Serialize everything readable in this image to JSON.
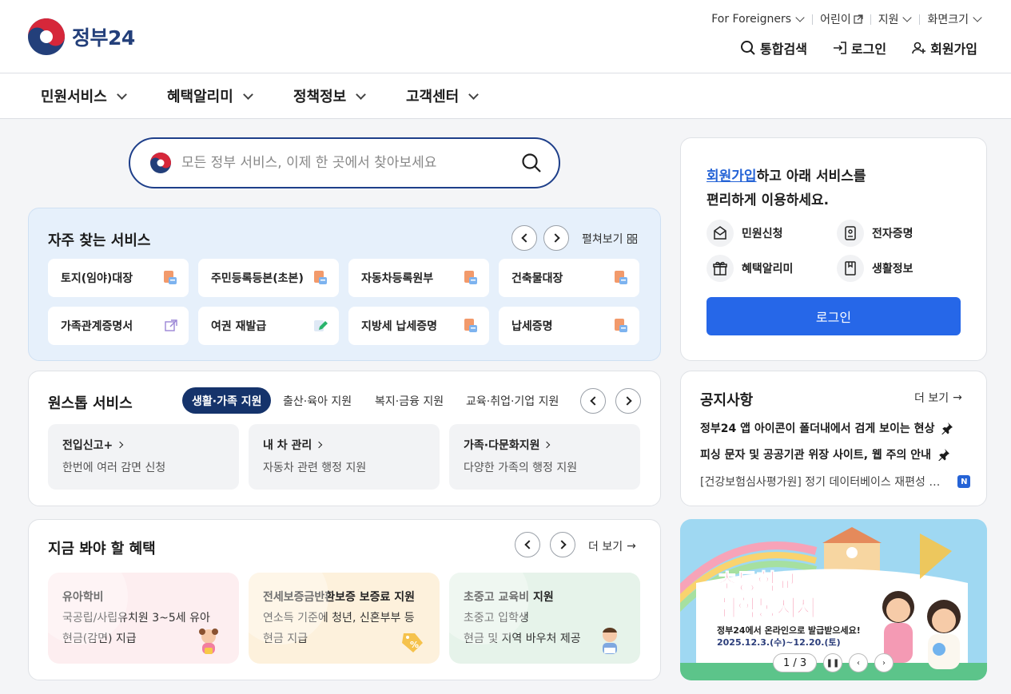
{
  "header": {
    "logo_text": "정부24",
    "util": [
      {
        "label": "For Foreigners"
      },
      {
        "label": "어린이"
      },
      {
        "label": "지원"
      },
      {
        "label": "화면크기"
      }
    ],
    "gnb": [
      {
        "label": "통합검색"
      },
      {
        "label": "로그인"
      },
      {
        "label": "회원가입"
      }
    ]
  },
  "nav": [
    "민원서비스",
    "혜택알리미",
    "정책정보",
    "고객센터"
  ],
  "search": {
    "placeholder": "모든 정부 서비스, 이제 한 곳에서 찾아보세요"
  },
  "frequent": {
    "title": "자주 찾는 서비스",
    "expand_label": "펼쳐보기",
    "items": [
      "토지(임야)대장",
      "주민등록등본(초본)",
      "자동차등록원부",
      "건축물대장",
      "가족관계증명서",
      "여권 재발급",
      "지방세 납세증명",
      "납세증명"
    ]
  },
  "onestop": {
    "title": "원스톱 서비스",
    "tabs": [
      "생활·가족 지원",
      "출산·육아 지원",
      "복지·금융 지원",
      "교육·취업·기업 지원"
    ],
    "cards": [
      {
        "title": "전입신고+",
        "desc": "한번에 여러 감면 신청"
      },
      {
        "title": "내 차 관리",
        "desc": "자동차 관련 행정 지원"
      },
      {
        "title": "가족·다문화지원",
        "desc": "다양한 가족의 행정 지원"
      }
    ]
  },
  "benefit": {
    "title": "지금 봐야 할 혜택",
    "more_label": "더 보기",
    "cards": [
      {
        "title": "유아학비",
        "line1": "국공립/사립유치원 3~5세 유아",
        "line2": "현금(감면) 지급",
        "color": "#fdeef0"
      },
      {
        "title": "전세보증금반환보증 보증료 지원",
        "line1": "연소득 기준에 청년, 신혼부부 등",
        "line2": "현금 지급",
        "color": "#fdf1dc"
      },
      {
        "title": "초중고 교육비 지원",
        "line1": "초중고 입학생",
        "line2": "현금 및 지역 바우처 제공",
        "color": "#e6f3ea"
      }
    ]
  },
  "login_panel": {
    "msg_link": "회원가입",
    "msg_rest1": "하고 아래 서비스를",
    "msg_line2": "편리하게 이용하세요.",
    "quick": [
      "민원신청",
      "전자증명",
      "혜택알리미",
      "생활정보"
    ],
    "button": "로그인"
  },
  "notice": {
    "title": "공지사항",
    "more_label": "더 보기",
    "items": [
      "정부24 앱 아이콘이 폴더내에서 검게 보이는 현상",
      "피싱 문자 및 공공기관 위장 사이트, 웹 주의 안내",
      "[건강보험심사평가원] 정기 데이터베이스 재편성 …"
    ],
    "badge": "N"
  },
  "banner": {
    "title_line1": "초등학교",
    "title_line2": "취학통지서",
    "subtitle": "정부24에서 온라인으로 발급받으세요!",
    "date": "2025.12.3.(수)~12.20.(토)",
    "pager": "1 / 3"
  },
  "colors": {
    "primary": "#2667e8",
    "navy": "#15336b",
    "accent_link": "#2563d6"
  }
}
